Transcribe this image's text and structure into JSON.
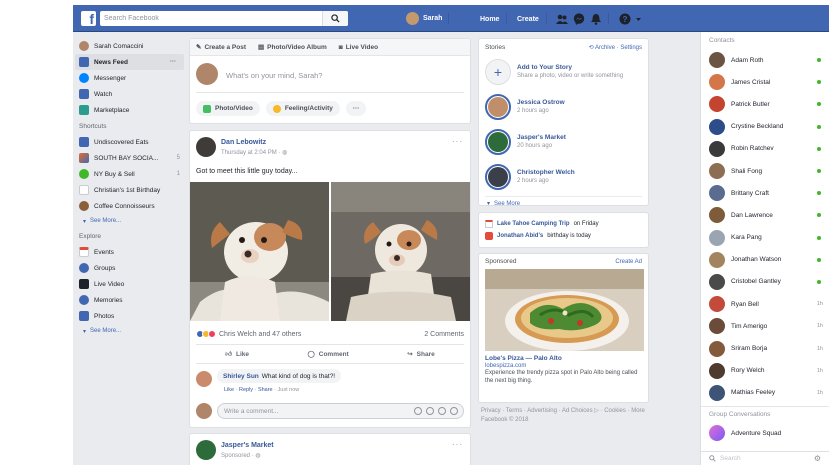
{
  "topbar": {
    "logo": "f",
    "search_placeholder": "Search Facebook",
    "user_name": "Sarah",
    "home_label": "Home",
    "create_label": "Create"
  },
  "leftnav": {
    "user_name": "Sarah Comaccini",
    "main": [
      {
        "label": "News Feed",
        "icon": "news-feed-icon",
        "color": "#4267b2",
        "more": "···"
      },
      {
        "label": "Messenger",
        "icon": "messenger-icon",
        "color": "#0084ff"
      },
      {
        "label": "Watch",
        "icon": "watch-icon",
        "color": "#4267b2"
      },
      {
        "label": "Marketplace",
        "icon": "marketplace-icon",
        "color": "#2a9d8f"
      }
    ],
    "shortcuts_heading": "Shortcuts",
    "shortcuts": [
      {
        "label": "Undiscovered Eats",
        "color": "#4267b2"
      },
      {
        "label": "SOUTH BAY SOCIA...",
        "color": "#e36e2c",
        "count": "5"
      },
      {
        "label": "NY Buy & Sell",
        "color": "#42b72a",
        "count": "1"
      },
      {
        "label": "Christian's 1st Birthday",
        "color": "#e9ebee"
      },
      {
        "label": "Coffee Connoisseurs",
        "color": "#8b5e3c"
      }
    ],
    "see_more": "See More...",
    "explore_heading": "Explore",
    "explore": [
      {
        "label": "Events",
        "color": "#e9ebee"
      },
      {
        "label": "Groups",
        "color": "#4267b2"
      },
      {
        "label": "Live Video",
        "color": "#1d2129"
      },
      {
        "label": "Memories",
        "color": "#4267b2"
      },
      {
        "label": "Photos",
        "color": "#4267b2"
      }
    ],
    "see_more_2": "See More..."
  },
  "composer": {
    "tabs": [
      "Create a Post",
      "Photo/Video Album",
      "Live Video"
    ],
    "placeholder": "What's on your mind, Sarah?",
    "photo_video": "Photo/Video",
    "feeling": "Feeling/Activity",
    "more": "···"
  },
  "post": {
    "author": "Dan Lebowitz",
    "time": "Thursday at 2:04 PM · ",
    "text": "Got to meet this little guy today...",
    "reactions": "Chris Welch and 47 others",
    "comments_count": "2 Comments",
    "like": "Like",
    "comment": "Comment",
    "share": "Share",
    "comment_author": "Shirley Sun",
    "comment_text": "What kind of dog is that?!",
    "comment_meta_like": "Like",
    "comment_meta_reply": "Reply",
    "comment_meta_share": "Share",
    "comment_meta_time": "· Just now",
    "write_placeholder": "Write a comment..."
  },
  "post2": {
    "author": "Jasper's Market",
    "time": "Sponsored · "
  },
  "stories": {
    "heading": "Stories",
    "archive": "Archive",
    "settings": "Settings",
    "add_title": "Add to Your Story",
    "add_sub": "Share a photo, video or write something",
    "items": [
      {
        "name": "Jessica Ostrow",
        "time": "2 hours ago",
        "color": "#c08f6a"
      },
      {
        "name": "Jasper's Market",
        "time": "20 hours ago",
        "color": "#2e6b3a"
      },
      {
        "name": "Christopher Welch",
        "time": "2 hours ago",
        "color": "#3a3f4a"
      }
    ],
    "see_more": "See More"
  },
  "events": {
    "event_name": "Lake Tahoe Camping Trip",
    "event_when": "on Friday",
    "birthday_name": "Jonathan Abid's",
    "birthday_text": "birthday is today"
  },
  "sponsored": {
    "heading": "Sponsored",
    "create_ad": "Create Ad",
    "title": "Lobe's Pizza — Palo Alto",
    "url": "lobespizza.com",
    "desc": "Experience the trendy pizza spot in Palo Alto being called the next big thing."
  },
  "footer": {
    "line1": "Privacy · Terms · Advertising · Ad Choices ▷ · Cookies · More",
    "line2": "Facebook © 2018"
  },
  "contacts": {
    "heading": "Contacts",
    "items": [
      {
        "name": "Adam Roth",
        "color": "#6b5443",
        "status": "online"
      },
      {
        "name": "James Cristal",
        "color": "#d3774a",
        "status": "online"
      },
      {
        "name": "Patrick Butler",
        "color": "#c3452f",
        "status": "online"
      },
      {
        "name": "Crystine Beckland",
        "color": "#2d4c8a",
        "status": "online"
      },
      {
        "name": "Robin Ratchev",
        "color": "#3a3a3a",
        "status": "online"
      },
      {
        "name": "Shali Fong",
        "color": "#8d6e52",
        "status": "online"
      },
      {
        "name": "Brittany Craft",
        "color": "#5a6c8f",
        "status": "online"
      },
      {
        "name": "Dan Lawrence",
        "color": "#7e5c3a",
        "status": "online"
      },
      {
        "name": "Kara Pang",
        "color": "#9aa5b1",
        "status": "online"
      },
      {
        "name": "Jonathan Watson",
        "color": "#a2855f",
        "status": "online"
      },
      {
        "name": "Cristobel Gantley",
        "color": "#4a4a4a",
        "status": "online"
      },
      {
        "name": "Ryan Bell",
        "color": "#c44a3b",
        "status": "time",
        "time": "1h"
      },
      {
        "name": "Tim Amerigo",
        "color": "#6b4b3a",
        "status": "time",
        "time": "1h"
      },
      {
        "name": "Sriram Borja",
        "color": "#835a3c",
        "status": "time",
        "time": "1h"
      },
      {
        "name": "Rory Welch",
        "color": "#4e3a2f",
        "status": "time",
        "time": "1h"
      },
      {
        "name": "Mathias Feeley",
        "color": "#3e5477",
        "status": "time",
        "time": "1h"
      }
    ],
    "group_heading": "Group Conversations",
    "group_item": "Adventure Squad",
    "search_placeholder": "Search"
  }
}
